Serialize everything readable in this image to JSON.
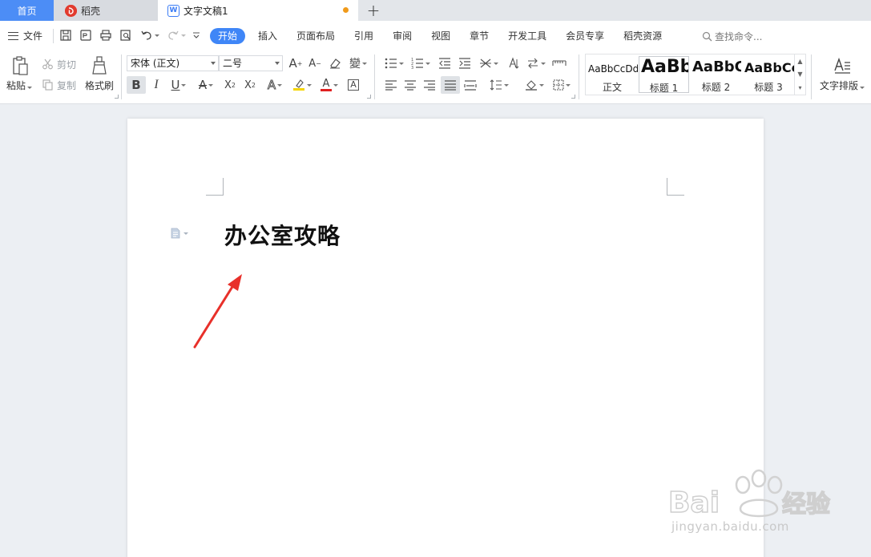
{
  "tabs": {
    "home": "首页",
    "daoke": "稻壳",
    "doc": "文字文稿1",
    "daoke_icon_letter": "",
    "doc_icon_letter": "W"
  },
  "menu": {
    "file": "文件",
    "tabs": [
      "开始",
      "插入",
      "页面布局",
      "引用",
      "审阅",
      "视图",
      "章节",
      "开发工具",
      "会员专享",
      "稻壳资源"
    ],
    "active_tab": "开始",
    "search_placeholder": "查找命令..."
  },
  "ribbon": {
    "paste": "粘贴",
    "cut": "剪切",
    "copy": "复制",
    "format_painter": "格式刷",
    "font_name": "宋体 (正文)",
    "font_size": "二号",
    "styles": [
      {
        "sample": "AaBbCcDd",
        "label": "正文"
      },
      {
        "sample": "AaBb",
        "label": "标题 1"
      },
      {
        "sample": "AaBbC",
        "label": "标题 2"
      },
      {
        "sample": "AaBbCc",
        "label": "标题 3"
      }
    ],
    "text_layout": "文字排版"
  },
  "document": {
    "heading": "办公室攻略"
  },
  "watermark": {
    "brand": "Baidu经验",
    "url": "jingyan.baidu.com"
  },
  "colors": {
    "accent_blue": "#3f86f7",
    "home_tab": "#4c8df6",
    "arrow_red": "#e8302a",
    "unsaved_dot": "#f09a1a",
    "highlight_yellow": "#f5d500",
    "font_color_red": "#e02020"
  }
}
